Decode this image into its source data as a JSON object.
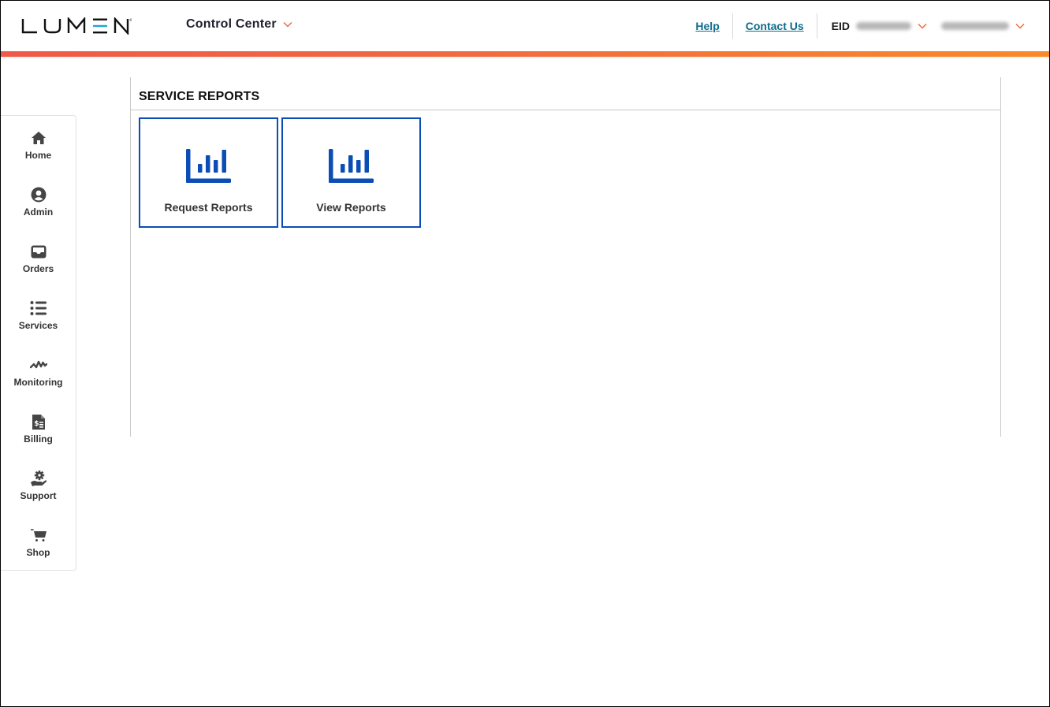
{
  "header": {
    "brand": "LUMEN",
    "app_switcher": "Control Center",
    "links": {
      "help": "Help",
      "contact": "Contact Us"
    },
    "eid_label": "EID",
    "eid_value_redacted": true,
    "user_redacted": true
  },
  "colors": {
    "brand_blue": "#0a4db4",
    "accent_teal": "#0c6c8c",
    "accent_orange": "#f26a3f",
    "logo_cyan": "#1fa4d8"
  },
  "sidebar": {
    "items": [
      {
        "label": "Home",
        "icon": "home-icon"
      },
      {
        "label": "Admin",
        "icon": "user-circle-icon"
      },
      {
        "label": "Orders",
        "icon": "inbox-tray-icon"
      },
      {
        "label": "Services",
        "icon": "list-icon"
      },
      {
        "label": "Monitoring",
        "icon": "pulse-icon"
      },
      {
        "label": "Billing",
        "icon": "invoice-dollar-icon"
      },
      {
        "label": "Support",
        "icon": "hand-gear-icon"
      },
      {
        "label": "Shop",
        "icon": "cart-icon"
      }
    ]
  },
  "main": {
    "section_title": "SERVICE REPORTS",
    "tiles": [
      {
        "label": "Request Reports",
        "icon": "bar-chart-icon"
      },
      {
        "label": "View Reports",
        "icon": "bar-chart-icon"
      }
    ]
  }
}
